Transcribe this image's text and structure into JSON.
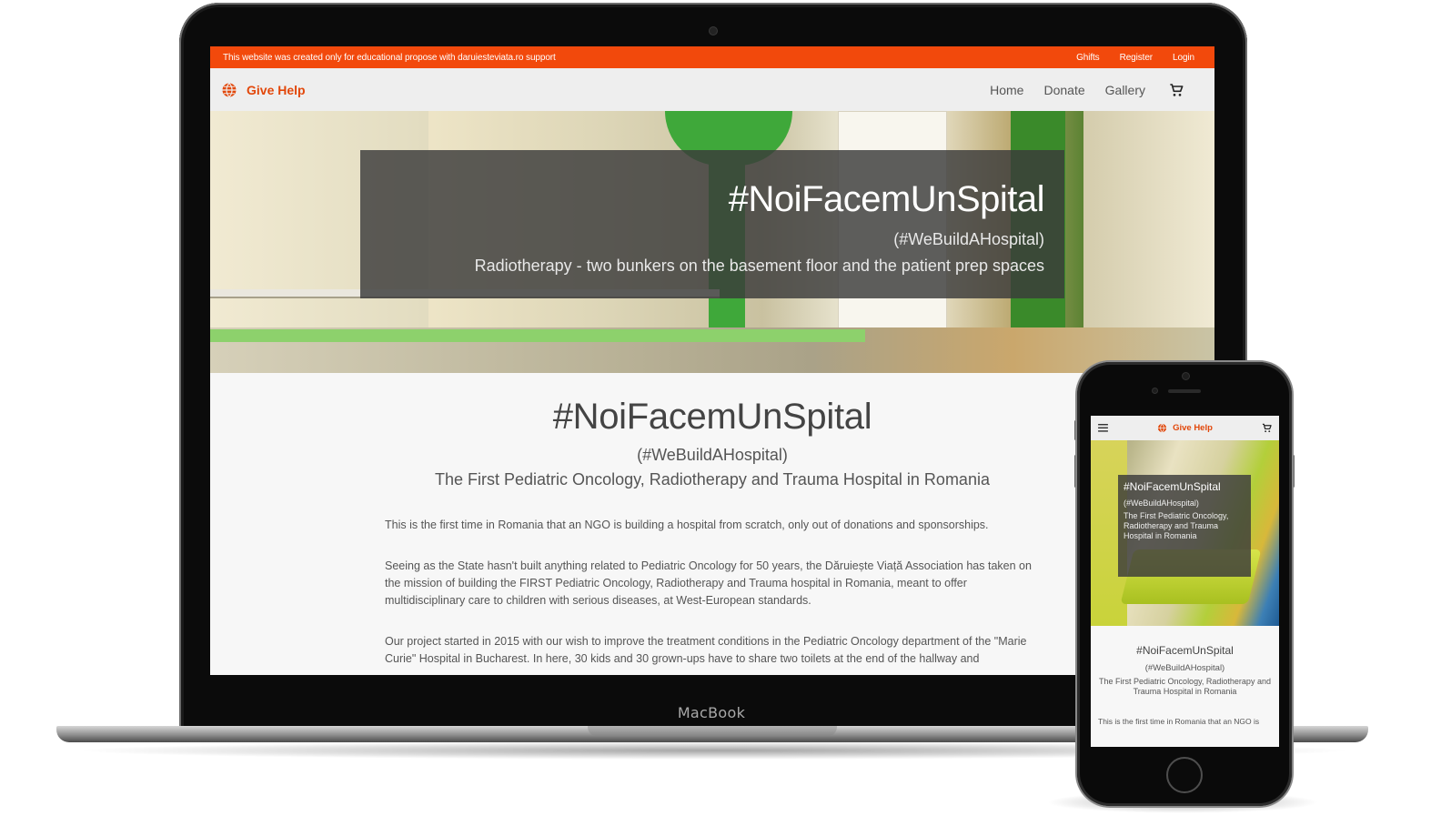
{
  "laptop": {
    "brand_label": "MacBook"
  },
  "site": {
    "notice": "This website was created only for educational propose with daruiesteviata.ro support",
    "top_links": [
      "Ghifts",
      "Register",
      "Login"
    ],
    "brand": "Give Help",
    "nav_links": [
      "Home",
      "Donate",
      "Gallery"
    ],
    "accent_color": "#f2490c",
    "icons": {
      "brand": "globe-icon",
      "cart": "shopping-cart-icon",
      "menu": "menu-icon"
    },
    "hero": {
      "title": "#NoiFacemUnSpital",
      "subtitle": "(#WeBuildAHospital)",
      "caption": "Radiotherapy - two bunkers on the basement floor and the patient prep spaces"
    },
    "main": {
      "title": "#NoiFacemUnSpital",
      "subtitle": "(#WeBuildAHospital)",
      "tagline": "The First Pediatric Oncology, Radiotherapy and Trauma Hospital in Romania",
      "paragraphs": [
        "This is the first time in Romania that an NGO is building a hospital from scratch, only out of donations and sponsorships.",
        "Seeing as the State hasn't built anything related to Pediatric Oncology for 50 years, the Dăruiește Viață Association has taken on the mission of building the FIRST Pediatric Oncology, Radiotherapy and Trauma hospital in Romania, meant to offer multidisciplinary care to children with serious diseases, at West-European standards.",
        "Our project started in 2015 with our wish to improve the treatment conditions in the Pediatric Oncology department of the \"Marie Curie\" Hospital in Bucharest. In here, 30 kids and 30 grown-ups have to share two toilets at the end of the hallway and"
      ]
    }
  },
  "phone": {
    "brand": "Give Help",
    "hero": {
      "title": "#NoiFacemUnSpital",
      "subtitle": "(#WeBuildAHospital)",
      "caption": "The First Pediatric Oncology, Radiotherapy and Trauma Hospital in Romania"
    },
    "main": {
      "title": "#NoiFacemUnSpital",
      "subtitle": "(#WeBuildAHospital)",
      "tagline": "The First Pediatric Oncology, Radiotherapy and Trauma Hospital in Romania",
      "paragraph_start": "This is the first time in Romania that an NGO is"
    }
  }
}
